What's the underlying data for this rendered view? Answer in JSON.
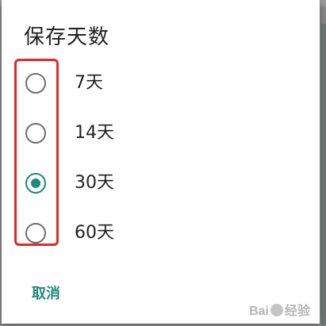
{
  "dialog": {
    "title": "保存天数",
    "options": [
      {
        "label": "7天",
        "checked": false
      },
      {
        "label": "14天",
        "checked": false
      },
      {
        "label": "30天",
        "checked": true
      },
      {
        "label": "60天",
        "checked": false
      }
    ],
    "cancel_label": "取消"
  },
  "watermark": {
    "text_left": "Bai",
    "text_right": "经验"
  },
  "colors": {
    "accent": "#1f8a78",
    "highlight_box": "#e02a2a",
    "radio_unchecked": "#6f6f6f"
  },
  "icons": {
    "radio_unchecked": "radio-unchecked-icon",
    "radio_checked": "radio-checked-icon"
  }
}
